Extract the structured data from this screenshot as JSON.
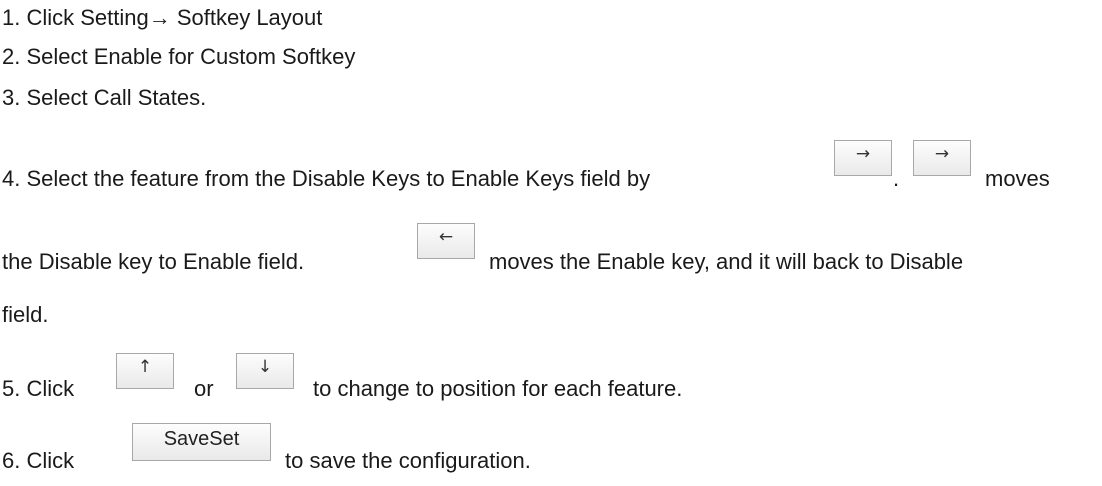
{
  "steps": {
    "step1": "1. Click Setting→ Softkey Layout",
    "step2": "2. Select Enable for Custom Softkey",
    "step3": "3. Select Call States.",
    "step4": {
      "part1": "4. Select the feature from the Disable Keys to Enable Keys field by",
      "sep": ".",
      "part2": "moves",
      "line2_part1": "the Disable key to Enable field.",
      "line2_part2": "moves the Enable key, and it will back to Disable",
      "line3": "field."
    },
    "step5": {
      "part1": "5. Click",
      "or": "or",
      "part2": "to change to position for each feature."
    },
    "step6": {
      "part1": "6. Click",
      "part2": "to save the configuration."
    }
  },
  "buttons": {
    "right_arrow": "→",
    "left_arrow": "←",
    "up_arrow": "↑",
    "down_arrow": "↓",
    "saveset": "SaveSet"
  }
}
